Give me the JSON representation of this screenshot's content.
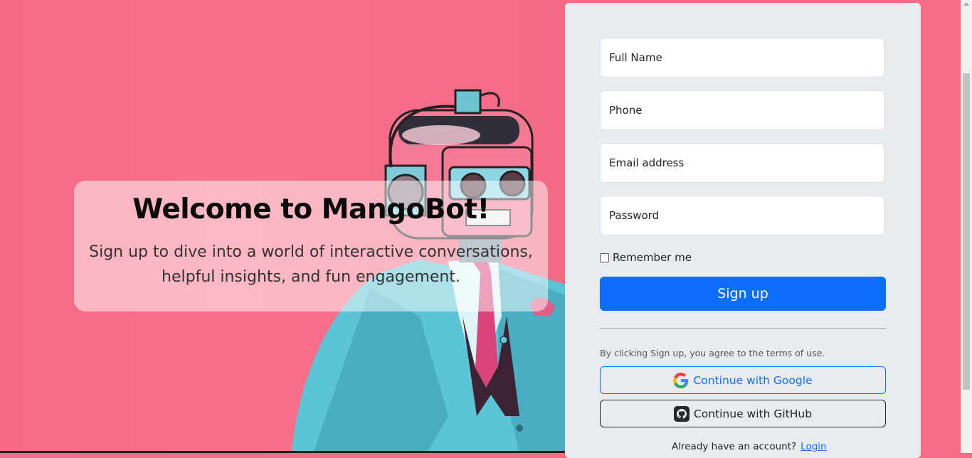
{
  "hero": {
    "title": "Welcome to MangoBot!",
    "subtitle": "Sign up to dive into a world of interactive conversations, helpful insights, and fun engagement."
  },
  "form": {
    "full_name_placeholder": "Full Name",
    "phone_placeholder": "Phone",
    "email_placeholder": "Email address",
    "password_placeholder": "Password",
    "remember_label": "Remember me",
    "signup_label": "Sign up",
    "terms_text": "By clicking Sign up, you agree to the terms of use.",
    "google_label": "Continue with Google",
    "github_label": "Continue with GitHub",
    "already_text": "Already have an account?",
    "login_label": "Login"
  },
  "colors": {
    "background": "#f66b85",
    "primary": "#0d6efd",
    "panel": "#e9ecef"
  }
}
